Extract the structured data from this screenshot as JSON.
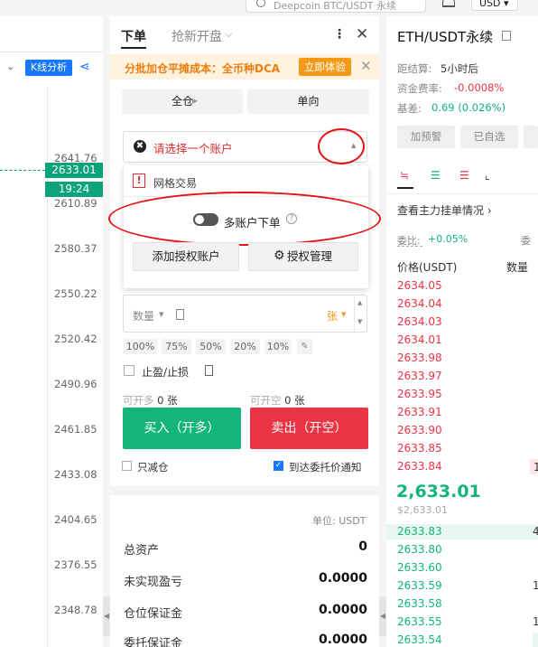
{
  "topbar": {
    "search_placeholder": "Deepcoin BTC/USDT 永续",
    "currency": "USD"
  },
  "chart": {
    "kline_label": "K线分析",
    "axis_ticks": [
      "2641.76",
      "2610.89",
      "2580.37",
      "2550.22",
      "2520.42",
      "2490.96",
      "2461.85",
      "2433.08",
      "2404.65",
      "2376.55",
      "2348.78"
    ],
    "current_price": "2633.01",
    "countdown": "19:24"
  },
  "order": {
    "tab_order": "下单",
    "tab_grab": "抢新开盘",
    "dca_text": "分批加仓平摊成本：全币种DCA",
    "dca_button": "立即体验",
    "margin_mode": "全仓",
    "position_mode": "单向",
    "account_placeholder": "请选择一个账户",
    "dropdown": {
      "grid_label": "网格交易",
      "multi_account": "多账户下单",
      "add_auth": "添加授权账户",
      "auth_manage": "授权管理"
    },
    "quantity_label": "数量",
    "unit": "张",
    "percents": [
      "100%",
      "75%",
      "50%",
      "20%",
      "10%"
    ],
    "tpsl_label": "止盈/止损",
    "can_open_long_label": "可开多",
    "can_open_long_val": "0 张",
    "can_open_short_label": "可开空",
    "can_open_short_val": "0 张",
    "buy_label": "买入（开多）",
    "sell_label": "卖出（开空）",
    "reduce_only": "只减仓",
    "notify_label": "到达委托价通知"
  },
  "assets": {
    "unit_label": "单位: USDT",
    "rows": [
      {
        "label": "总资产",
        "value": "0"
      },
      {
        "label": "未实现盈亏",
        "value": "0.0000"
      },
      {
        "label": "仓位保证金",
        "value": "0.0000"
      },
      {
        "label": "委托保证金",
        "value": "0.0000"
      }
    ]
  },
  "book": {
    "pair": "ETH/USDT永续",
    "settle_label": "距结算:",
    "settle_val": "5小时后",
    "funding_label": "资金费率:",
    "funding_val": "-0.0008%",
    "basis_label": "基差:",
    "basis_val": "0.69 (0.026%)",
    "alert_btn": "加预警",
    "fav_btn": "已自选",
    "main_orders": "查看主力挂单情况",
    "ratio_label": "委比:",
    "ratio_val": "+0.05%",
    "ratio_cut": "委",
    "col_price": "价格(USDT)",
    "col_qty": "数量",
    "asks": [
      "2634.05",
      "2634.04",
      "2634.03",
      "2634.01",
      "2633.98",
      "2633.97",
      "2633.95",
      "2633.91",
      "2633.90",
      "2633.85",
      "2633.84"
    ],
    "ask_last_qty": "1",
    "last_price": "2,633.01",
    "mark_price": "$2,633.01",
    "bids": [
      "2633.83",
      "2633.80",
      "2633.60",
      "2633.59",
      "2633.58",
      "2633.55",
      "2633.54"
    ],
    "bid_qty_1": "4",
    "bid_qty_2": "1",
    "bid_qty_3": "1"
  },
  "colors": {
    "buy_green": "#13b578",
    "sell_red": "#ea3443",
    "accent_orange": "#f29a17",
    "brand_blue": "#1677ff",
    "annotation_red": "#e81010"
  }
}
